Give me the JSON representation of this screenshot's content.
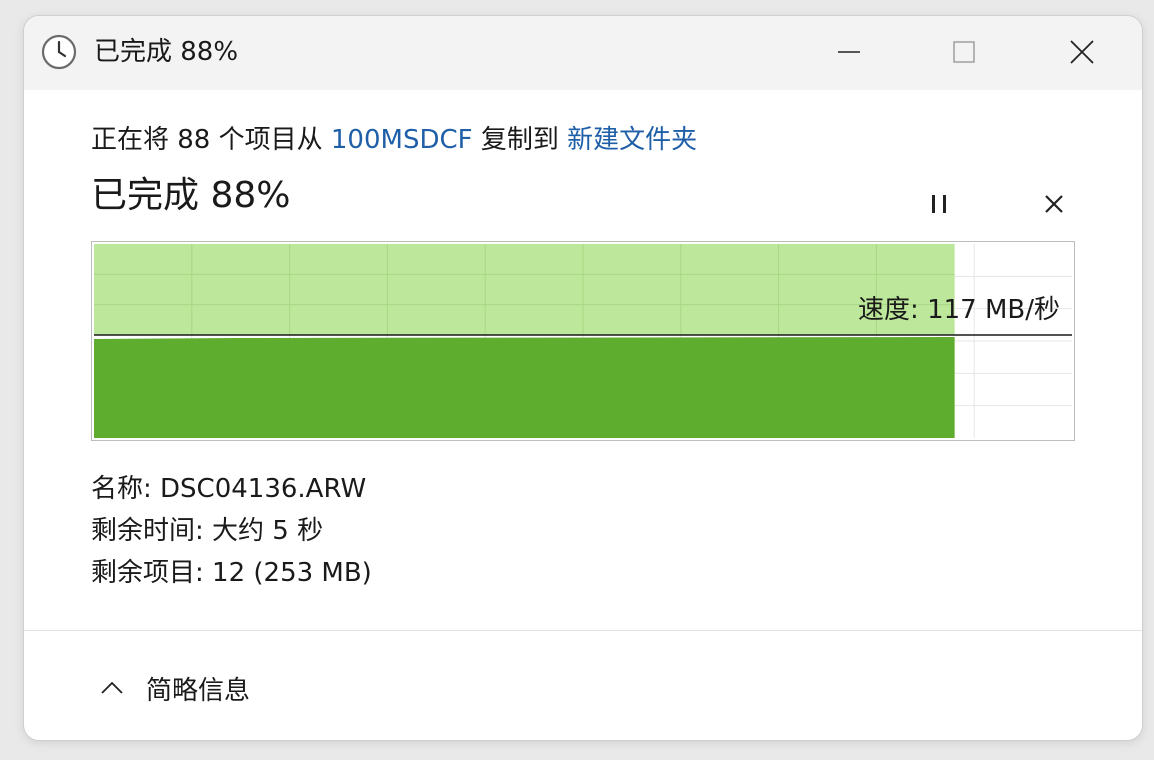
{
  "window": {
    "title": "已完成 88%",
    "icon": "clock-icon"
  },
  "transfer": {
    "prefix": "正在将 88 个项目从 ",
    "source": "100MSDCF",
    "middle": " 复制到 ",
    "destination": "新建文件夹",
    "status": "已完成 88%",
    "progress": 0.88,
    "speed_label": "速度: 117 MB/秒"
  },
  "details": {
    "name_label": "名称: ",
    "name_value": "DSC04136.ARW",
    "time_label": "剩余时间: ",
    "time_value": "大约 5 秒",
    "items_label": "剩余项目: ",
    "items_value": "12 (253 MB)"
  },
  "footer": {
    "toggle_label": "简略信息"
  },
  "colors": {
    "link": "#1f5fa8",
    "fill_dark": "#5fad2e",
    "fill_light": "#bde79a"
  }
}
